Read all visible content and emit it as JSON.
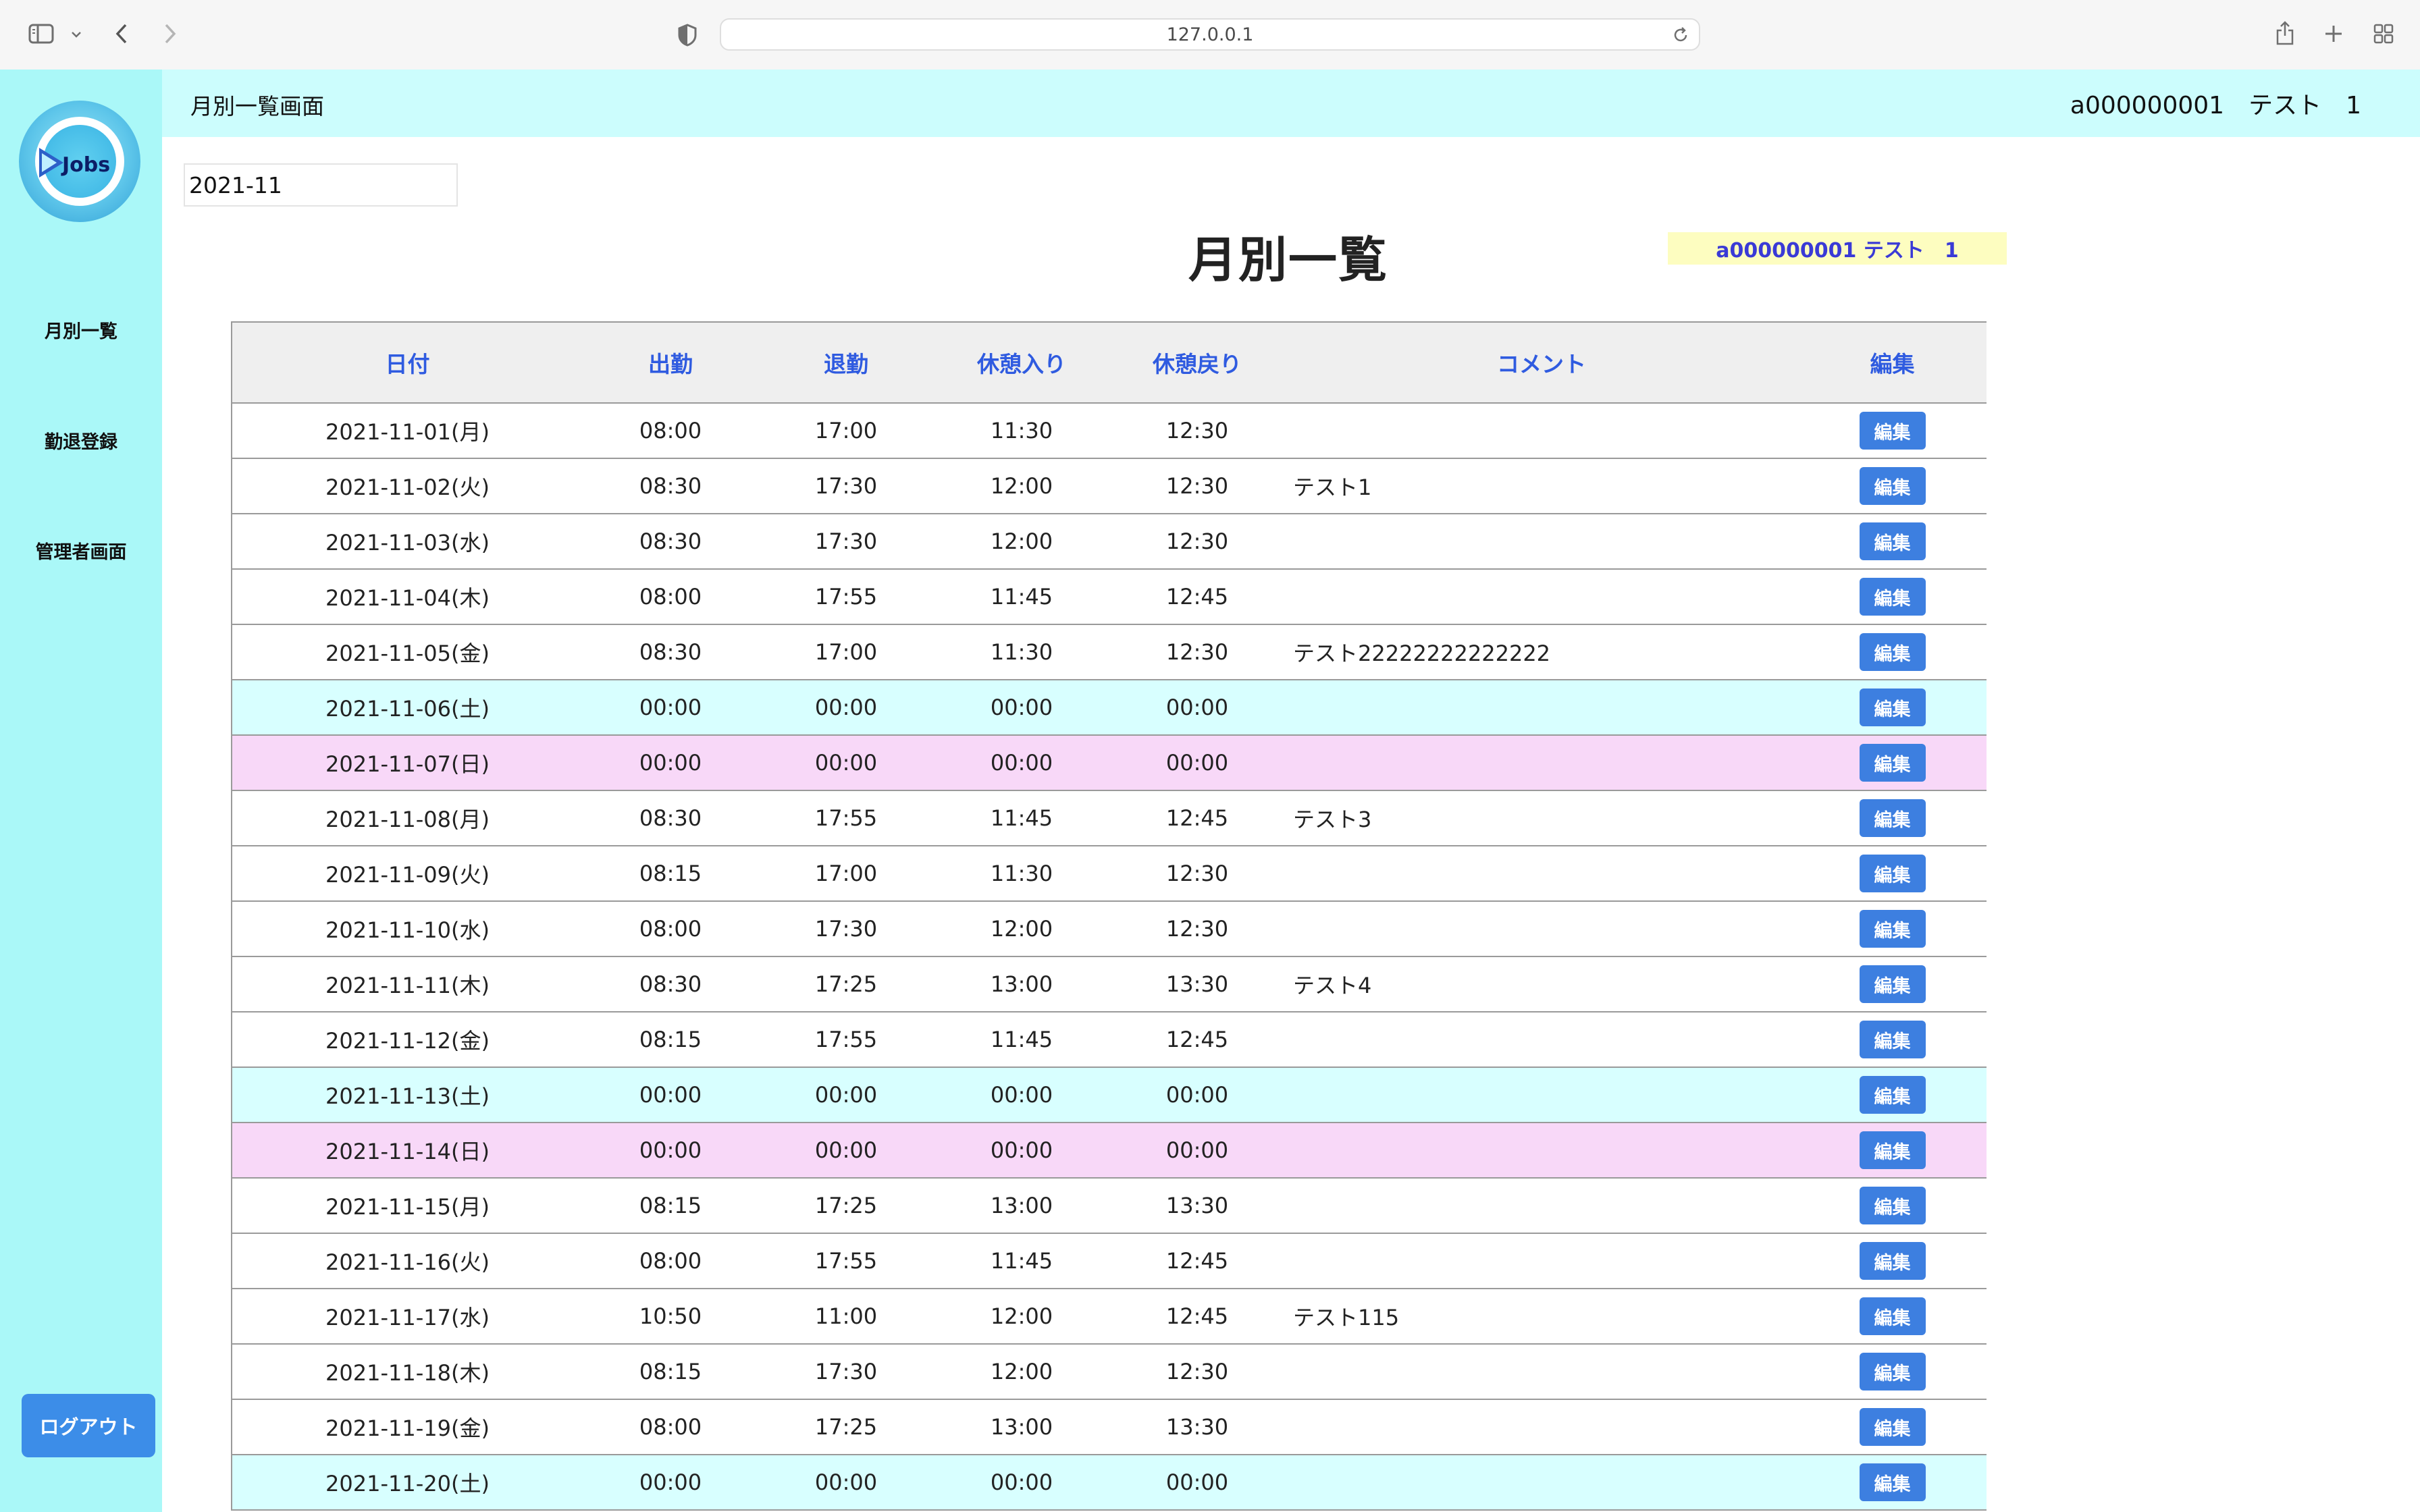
{
  "browser": {
    "url": "127.0.0.1"
  },
  "sidebar": {
    "logo_text": "Jobs",
    "items": [
      {
        "label": "月別一覧"
      },
      {
        "label": "勤退登録"
      },
      {
        "label": "管理者画面"
      }
    ],
    "logout_label": "ログアウト"
  },
  "header": {
    "screen_title": "月別一覧画面",
    "user_info": "a000000001　テスト　1"
  },
  "main": {
    "month_value": "2021-11",
    "title": "月別一覧",
    "user_badge": "a000000001  テスト　1"
  },
  "table": {
    "columns": [
      "日付",
      "出勤",
      "退勤",
      "休憩入り",
      "休憩戻り",
      "コメント",
      "編集"
    ],
    "edit_label": "編集",
    "rows": [
      {
        "date": "2021-11-01(月)",
        "in": "08:00",
        "out": "17:00",
        "break_in": "11:30",
        "break_out": "12:30",
        "comment": "",
        "day_type": "weekday"
      },
      {
        "date": "2021-11-02(火)",
        "in": "08:30",
        "out": "17:30",
        "break_in": "12:00",
        "break_out": "12:30",
        "comment": "テスト1",
        "day_type": "weekday"
      },
      {
        "date": "2021-11-03(水)",
        "in": "08:30",
        "out": "17:30",
        "break_in": "12:00",
        "break_out": "12:30",
        "comment": "",
        "day_type": "weekday"
      },
      {
        "date": "2021-11-04(木)",
        "in": "08:00",
        "out": "17:55",
        "break_in": "11:45",
        "break_out": "12:45",
        "comment": "",
        "day_type": "weekday"
      },
      {
        "date": "2021-11-05(金)",
        "in": "08:30",
        "out": "17:00",
        "break_in": "11:30",
        "break_out": "12:30",
        "comment": "テスト22222222222222",
        "day_type": "weekday"
      },
      {
        "date": "2021-11-06(土)",
        "in": "00:00",
        "out": "00:00",
        "break_in": "00:00",
        "break_out": "00:00",
        "comment": "",
        "day_type": "sat"
      },
      {
        "date": "2021-11-07(日)",
        "in": "00:00",
        "out": "00:00",
        "break_in": "00:00",
        "break_out": "00:00",
        "comment": "",
        "day_type": "sun"
      },
      {
        "date": "2021-11-08(月)",
        "in": "08:30",
        "out": "17:55",
        "break_in": "11:45",
        "break_out": "12:45",
        "comment": "テスト3",
        "day_type": "weekday"
      },
      {
        "date": "2021-11-09(火)",
        "in": "08:15",
        "out": "17:00",
        "break_in": "11:30",
        "break_out": "12:30",
        "comment": "",
        "day_type": "weekday"
      },
      {
        "date": "2021-11-10(水)",
        "in": "08:00",
        "out": "17:30",
        "break_in": "12:00",
        "break_out": "12:30",
        "comment": "",
        "day_type": "weekday"
      },
      {
        "date": "2021-11-11(木)",
        "in": "08:30",
        "out": "17:25",
        "break_in": "13:00",
        "break_out": "13:30",
        "comment": "テスト4",
        "day_type": "weekday"
      },
      {
        "date": "2021-11-12(金)",
        "in": "08:15",
        "out": "17:55",
        "break_in": "11:45",
        "break_out": "12:45",
        "comment": "",
        "day_type": "weekday"
      },
      {
        "date": "2021-11-13(土)",
        "in": "00:00",
        "out": "00:00",
        "break_in": "00:00",
        "break_out": "00:00",
        "comment": "",
        "day_type": "sat"
      },
      {
        "date": "2021-11-14(日)",
        "in": "00:00",
        "out": "00:00",
        "break_in": "00:00",
        "break_out": "00:00",
        "comment": "",
        "day_type": "sun"
      },
      {
        "date": "2021-11-15(月)",
        "in": "08:15",
        "out": "17:25",
        "break_in": "13:00",
        "break_out": "13:30",
        "comment": "",
        "day_type": "weekday"
      },
      {
        "date": "2021-11-16(火)",
        "in": "08:00",
        "out": "17:55",
        "break_in": "11:45",
        "break_out": "12:45",
        "comment": "",
        "day_type": "weekday"
      },
      {
        "date": "2021-11-17(水)",
        "in": "10:50",
        "out": "11:00",
        "break_in": "12:00",
        "break_out": "12:45",
        "comment": "テスト115",
        "day_type": "weekday"
      },
      {
        "date": "2021-11-18(木)",
        "in": "08:15",
        "out": "17:30",
        "break_in": "12:00",
        "break_out": "12:30",
        "comment": "",
        "day_type": "weekday"
      },
      {
        "date": "2021-11-19(金)",
        "in": "08:00",
        "out": "17:25",
        "break_in": "13:00",
        "break_out": "13:30",
        "comment": "",
        "day_type": "weekday"
      },
      {
        "date": "2021-11-20(土)",
        "in": "00:00",
        "out": "00:00",
        "break_in": "00:00",
        "break_out": "00:00",
        "comment": "",
        "day_type": "sat"
      }
    ]
  },
  "colors": {
    "sidebar_bg": "#aaf8f8",
    "header_bg": "#ccfdfd",
    "accent_blue": "#3d7fe0",
    "saturday_row": "#d8ffff",
    "sunday_row": "#f8d8f8",
    "badge_bg": "#fdfdc0"
  }
}
